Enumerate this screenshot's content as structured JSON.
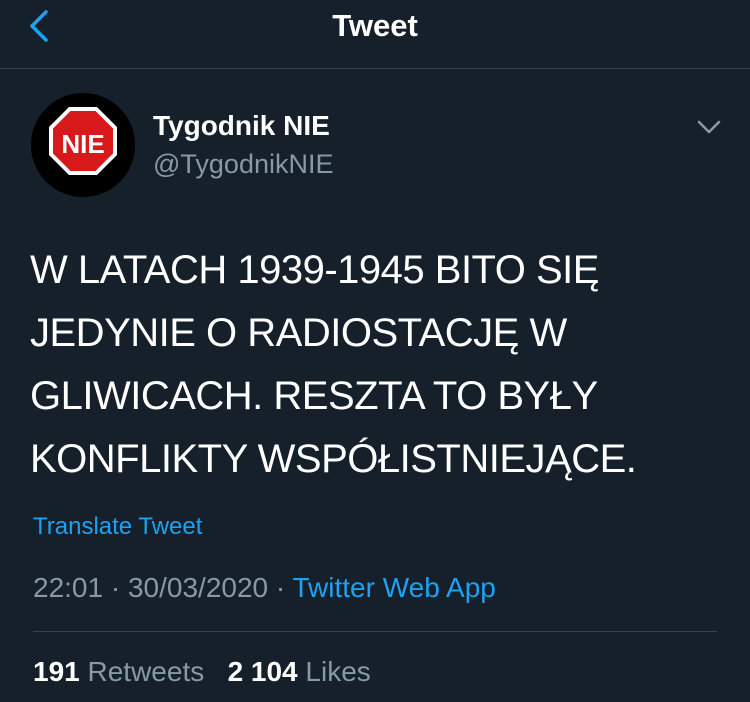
{
  "header": {
    "title": "Tweet",
    "back_icon": "chevron-left-icon"
  },
  "author": {
    "avatar_text": "NIE",
    "display_name": "Tygodnik NIE",
    "handle": "@TygodnikNIE"
  },
  "tweet": {
    "text_lines": [
      "W LATACH 1939-1945 BITO SIĘ",
      "JEDYNIE O RADIOSTACJĘ W",
      "GLIWICACH. RESZTA TO BYŁY",
      "KONFLIKTY WSPÓŁISTNIEJĄCE."
    ],
    "translate_label": "Translate Tweet",
    "time": "22:01",
    "date": "30/03/2020",
    "separator": "·",
    "source": "Twitter Web App"
  },
  "stats": {
    "retweets_count": "191",
    "retweets_label": "Retweets",
    "likes_count": "2 104",
    "likes_label": "Likes"
  },
  "colors": {
    "background": "#15202b",
    "accent": "#1da1f2",
    "secondary_text": "#8899a6",
    "divider": "#38444d",
    "avatar_sign": "#d7191b"
  }
}
